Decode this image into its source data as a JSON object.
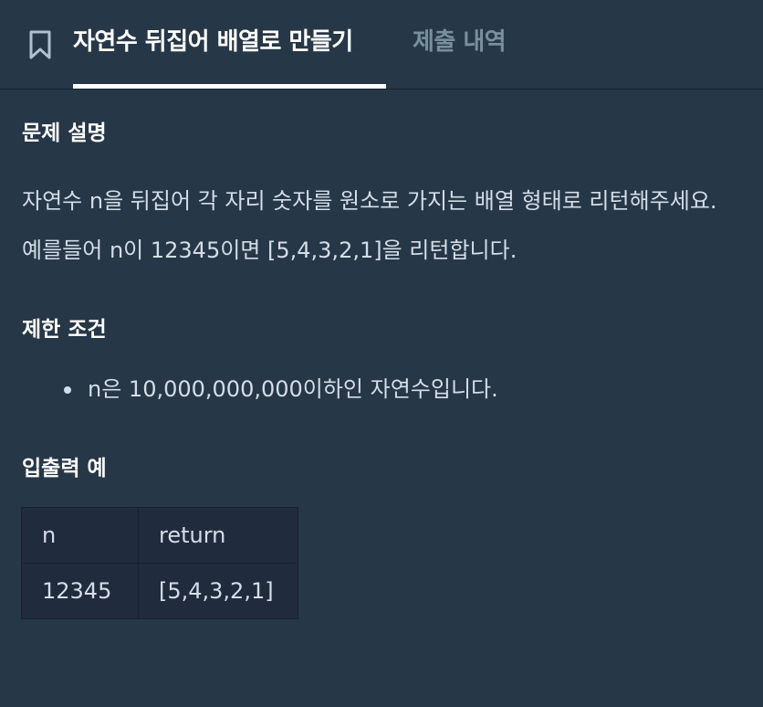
{
  "tabs": {
    "active_label": "자연수 뒤집어 배열로 만들기",
    "inactive_label": "제출 내역"
  },
  "description": {
    "heading": "문제 설명",
    "text": "자연수 n을 뒤집어 각 자리 숫자를 원소로 가지는 배열 형태로 리턴해주세요. 예를들어 n이 12345이면 [5,4,3,2,1]을 리턴합니다."
  },
  "constraints": {
    "heading": "제한 조건",
    "items": [
      "n은 10,000,000,000이하인 자연수입니다."
    ]
  },
  "examples": {
    "heading": "입출력 예",
    "columns": [
      "n",
      "return"
    ],
    "rows": [
      [
        "12345",
        "[5,4,3,2,1]"
      ]
    ]
  },
  "icons": {
    "bookmark": "bookmark-icon"
  },
  "colors": {
    "background": "#263747",
    "table_background": "#202b3d",
    "active_tab": "#ffffff",
    "inactive_tab": "#78909c",
    "text": "#d5dde6"
  }
}
